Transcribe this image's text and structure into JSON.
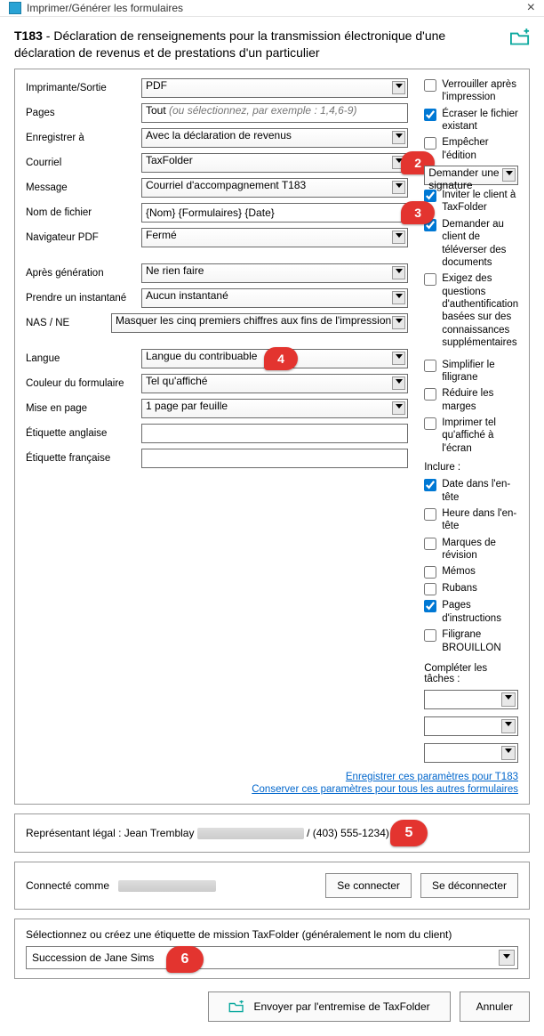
{
  "window": {
    "title": "Imprimer/Générer les formulaires",
    "heading_bold": "T183",
    "heading_rest": " - Déclaration de renseignements pour la transmission électronique d'une déclaration de revenus et de prestations d'un particulier"
  },
  "left": {
    "imprimante_label": "Imprimante/Sortie",
    "imprimante_value": "PDF",
    "pages_label": "Pages",
    "pages_prefix": "Tout ",
    "pages_hint": "(ou sélectionnez, par exemple : 1,4,6-9)",
    "enregistrer_label": "Enregistrer à",
    "enregistrer_value": "Avec la déclaration de revenus",
    "courriel_label": "Courriel",
    "courriel_value": "TaxFolder",
    "message_label": "Message",
    "message_value": "Courriel d'accompagnement T183",
    "nom_fichier_label": "Nom de fichier",
    "nom_fichier_value": "{Nom} {Formulaires} {Date}",
    "navigateur_label": "Navigateur PDF",
    "navigateur_value": "Fermé",
    "apres_label": "Après génération",
    "apres_value": "Ne rien faire",
    "instantane_label": "Prendre un instantané",
    "instantane_value": "Aucun instantané",
    "nas_label": "NAS / NE",
    "nas_value": "Masquer les cinq premiers chiffres aux fins de l'impression",
    "langue_label": "Langue",
    "langue_value": "Langue du contribuable",
    "couleur_label": "Couleur du formulaire",
    "couleur_value": "Tel qu'affiché",
    "mise_label": "Mise en page",
    "mise_value": "1 page par feuille",
    "et_ang_label": "Étiquette anglaise",
    "et_fra_label": "Étiquette française"
  },
  "right": {
    "verrouiller": "Verrouiller après l'impression",
    "ecraser": "Écraser le fichier existant",
    "empecher": "Empêcher l'édition",
    "demander_sig": "Demander une signature",
    "inviter": "Inviter le client à TaxFolder",
    "demander_tele": "Demander au client de téléverser des documents",
    "exigez": "Exigez des questions d'authentification basées sur des connaissances supplémentaires",
    "simplifier": "Simplifier le filigrane",
    "reduire": "Réduire les marges",
    "imprimer_tel": "Imprimer tel qu'affiché à l'écran",
    "inclure": "Inclure :",
    "date_entete": "Date dans l'en-tête",
    "heure_entete": "Heure dans l'en-tête",
    "marques": "Marques de révision",
    "memos": "Mémos",
    "rubans": "Rubans",
    "pages_instr": "Pages d'instructions",
    "filigrane": "Filigrane BROUILLON",
    "completer": "Compléter les tâches :",
    "link1": "Enregistrer ces paramètres pour T183",
    "link2": "Conserver ces paramètres pour tous les autres formulaires"
  },
  "rep": {
    "label": "Représentant légal  :",
    "name": "Jean Tremblay",
    "phone": "/ (403) 555-1234)"
  },
  "conn": {
    "label": "Connecté comme",
    "se_connecter": "Se connecter",
    "se_deconnecter": "Se déconnecter"
  },
  "tag": {
    "prompt": "Sélectionnez ou créez une étiquette de mission TaxFolder (généralement le nom du client)",
    "value": "Succession de Jane Sims"
  },
  "footer": {
    "send": "Envoyer par l'entremise de TaxFolder",
    "cancel": "Annuler"
  },
  "badges": {
    "b2": "2",
    "b3": "3",
    "b4": "4",
    "b5": "5",
    "b6": "6"
  }
}
